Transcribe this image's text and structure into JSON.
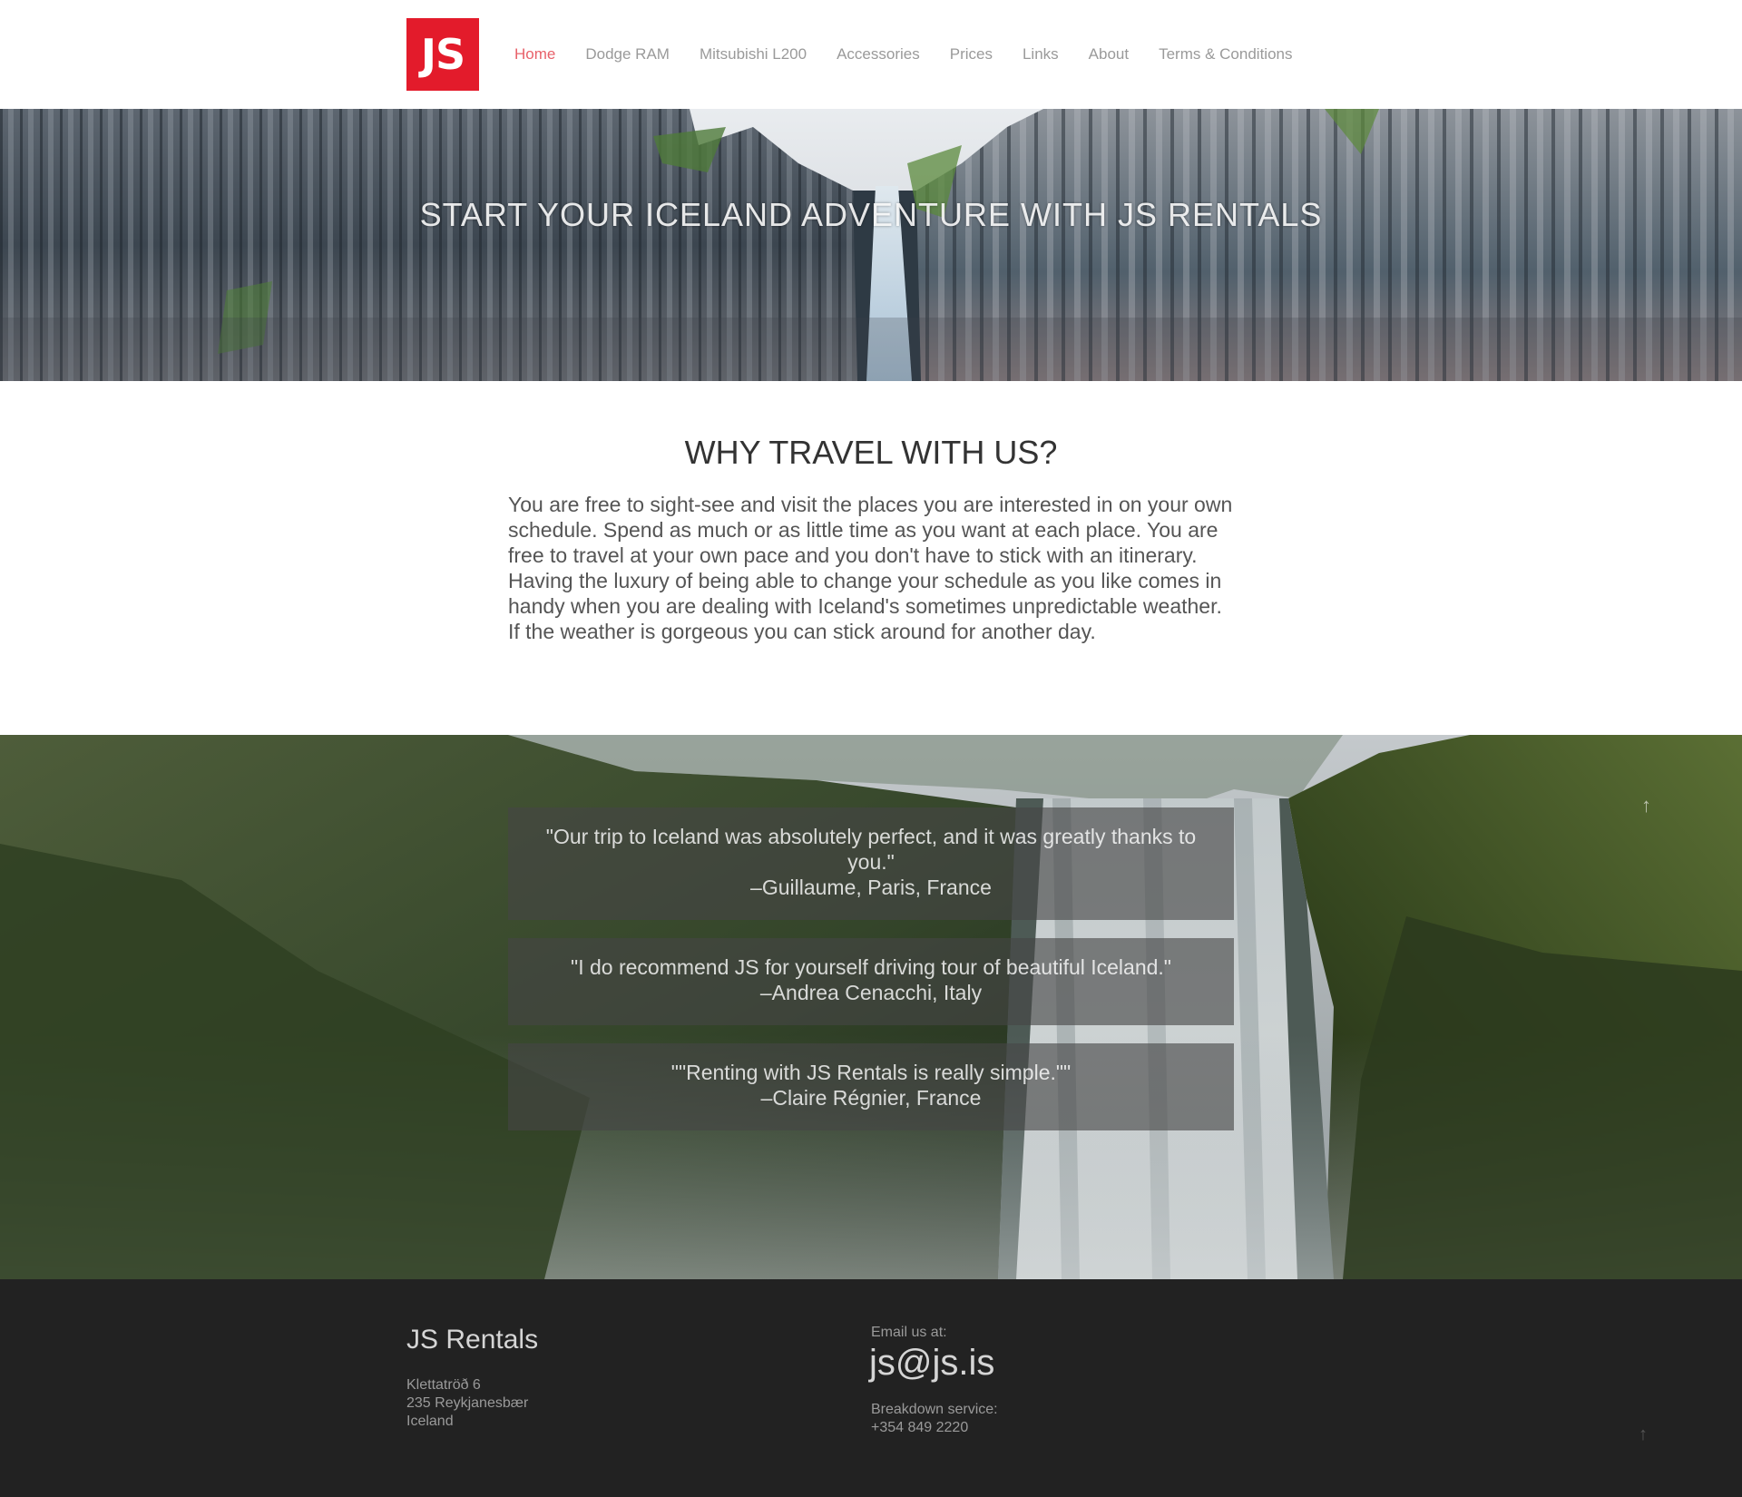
{
  "header": {
    "logo_text": "JS",
    "nav": [
      {
        "label": "Home",
        "active": true
      },
      {
        "label": "Dodge RAM"
      },
      {
        "label": "Mitsubishi L200"
      },
      {
        "label": "Accessories"
      },
      {
        "label": "Prices"
      },
      {
        "label": "Links"
      },
      {
        "label": "About"
      },
      {
        "label": "Terms & Conditions"
      }
    ]
  },
  "hero": {
    "title": "START YOUR ICELAND ADVENTURE WITH JS RENTALS"
  },
  "why": {
    "heading": "WHY TRAVEL WITH US?",
    "body": "You are free to sight-see and visit the places you are interested in on your own schedule. Spend as much or as little time as you want at each place. You are free to travel at your own pace and you don't have to stick with an itinerary. Having the luxury of being able to change your schedule as you like comes in handy when you are dealing with Iceland's sometimes unpredictable weather. If the weather is gorgeous you can stick around for another day."
  },
  "testimonials": [
    {
      "quote": "\"Our trip to Iceland was absolutely perfect, and it was greatly thanks to you.\"",
      "author": "–Guillaume, Paris, France"
    },
    {
      "quote": "\"I do recommend JS for yourself driving tour of beautiful Iceland.\"",
      "author": "–Andrea Cenacchi, Italy"
    },
    {
      "quote": "\"\"Renting with JS Rentals is really simple.\"\"",
      "author": "–Claire Régnier, France"
    }
  ],
  "footer": {
    "brand": "JS Rentals",
    "address": [
      "Klettatröð 6",
      "235 Reykjanesbær",
      "Iceland"
    ],
    "email_label": "Email us at:",
    "email": "js@js.is",
    "breakdown_label": "Breakdown service:",
    "breakdown_phone": "+354 849 2220"
  },
  "icons": {
    "scroll_up": "↑"
  },
  "colors": {
    "brand_red": "#e31b2b",
    "nav_active": "#e8616a",
    "footer_bg": "#222222"
  }
}
